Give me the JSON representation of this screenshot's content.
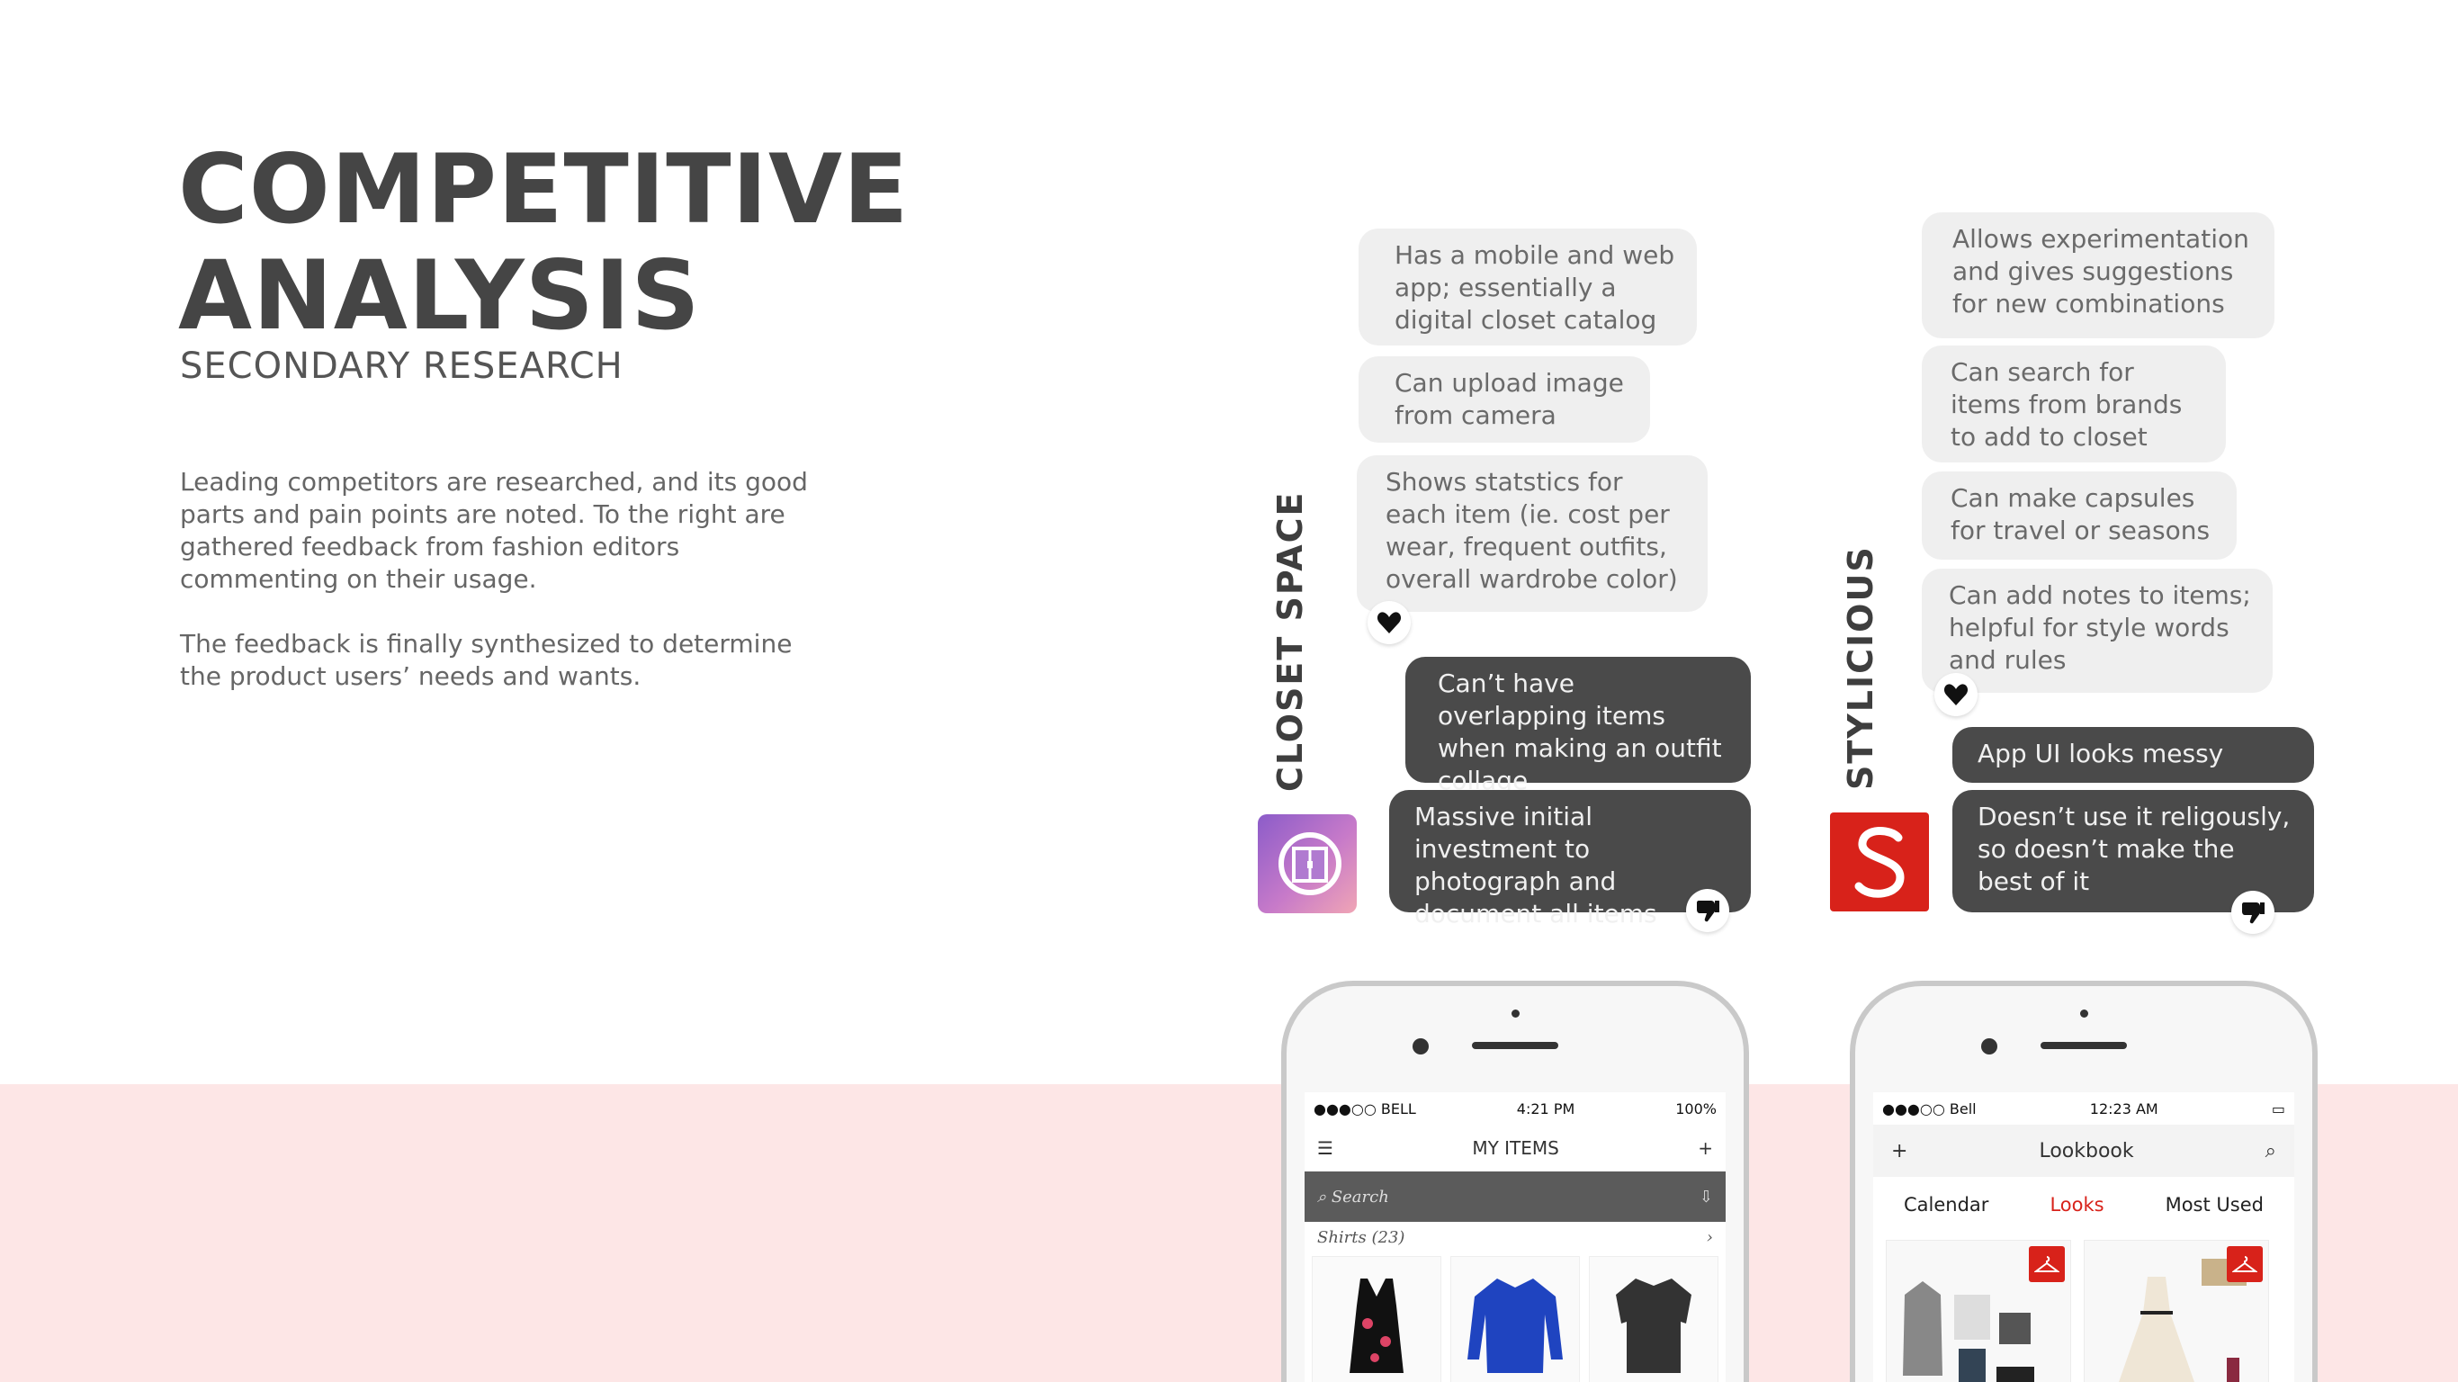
{
  "header": {
    "title_line1": "COMPETITIVE",
    "title_line2": "ANALYSIS",
    "subtitle": "SECONDARY RESEARCH"
  },
  "description": {
    "paragraph1": "Leading competitors are researched, and its good parts and pain points are noted. To the right are gathered feedback from fashion editors commenting on their usage.",
    "paragraph2": "The feedback is finally synthesized to determine the product users’ needs and wants."
  },
  "closet_space": {
    "name": "CLOSET SPACE",
    "pros": [
      "Has a mobile and web app; essentially a digital closet catalog",
      "Can upload image from camera",
      "Shows statstics for each item (ie. cost per wear, frequent outfits, overall wardrobe color)"
    ],
    "cons": [
      "Can’t have overlapping items when making an outfit collage",
      "Massive initial investment to photograph and document all items"
    ],
    "phone": {
      "carrier": "●●●○○ BELL",
      "time": "4:21 PM",
      "battery": "100%",
      "nav_title": "MY ITEMS",
      "search_placeholder": "Search",
      "section": "Shirts (23)"
    }
  },
  "stylicious": {
    "name": "STYLICIOUS",
    "pros": [
      "Allows experimentation and gives suggestions for new combinations",
      "Can search for items from brands to add to closet",
      "Can make capsules for travel or seasons",
      "Can add notes to items; helpful for style words and rules"
    ],
    "cons": [
      "App UI looks messy",
      "Doesn’t use it religously, so doesn’t make the best of it"
    ],
    "phone": {
      "carrier": "●●●○○ Bell",
      "time": "12:23 AM",
      "nav_title": "Lookbook",
      "tabs": [
        "Calendar",
        "Looks",
        "Most Used"
      ]
    }
  },
  "icons": {
    "like": "heart-icon",
    "dislike": "thumbs-down-icon"
  },
  "colors": {
    "band": "#fde6e6",
    "dark_bubble": "#4a4a4a",
    "light_bubble": "#efefef",
    "stylicious_red": "#d8221a"
  }
}
